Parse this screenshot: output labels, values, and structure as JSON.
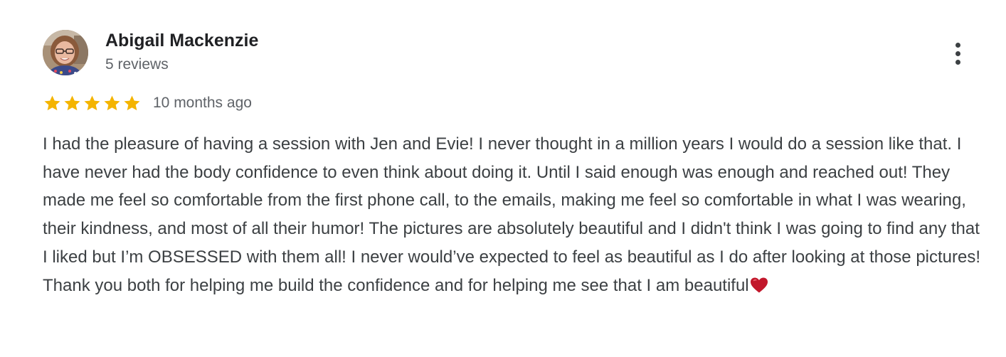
{
  "review": {
    "author": {
      "name": "Abigail Mackenzie",
      "review_count": "5 reviews",
      "avatar_icon": "user-photo-avatar"
    },
    "rating": {
      "stars": 5,
      "max_stars": 5,
      "star_color": "#f4b400"
    },
    "date": "10 months ago",
    "text": "I had the pleasure of having a session with Jen and Evie! I never thought in a million years I would do a session like that. I have never had the body confidence to even think about doing it. Until I said enough was enough and reached out! They made me feel so comfortable from the first phone call, to the emails, making me feel so comfortable in what I was wearing, their kindness, and most of all their humor! The pictures are absolutely beautiful and I didn't think I was going to find any that I liked but I’m OBSESSED with them all! I never would’ve expected to feel as beautiful as I do after looking at those pictures! Thank you both for helping me build the confidence and for helping me see that I am beautiful",
    "trailing_emoji": "red-heart-icon",
    "menu_icon": "more-vert-icon"
  }
}
